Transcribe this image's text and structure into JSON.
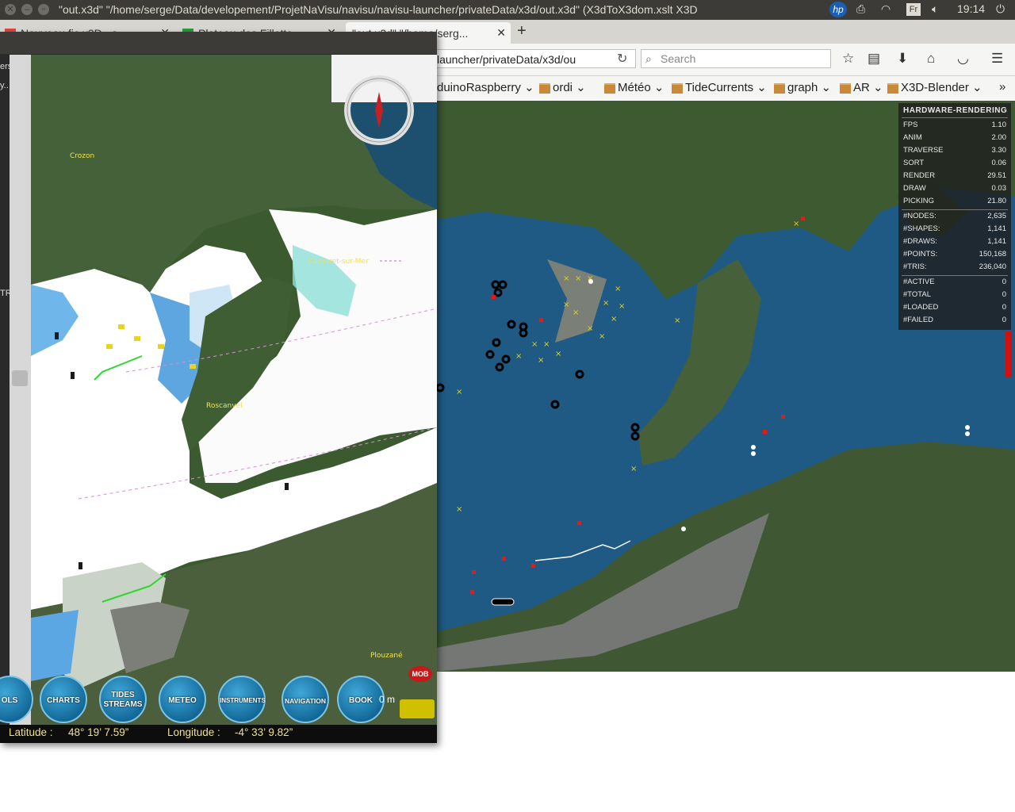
{
  "system": {
    "window_title": "\"out.x3d\" \"/home/serge/Data/developement/ProjetNaVisu/navisu/navisu-launcher/privateData/x3d/out.x3d\" (X3dToX3dom.xslt X3D",
    "keyboard_layout": "Fr",
    "clock": "19:14",
    "icons": [
      "hp-icon",
      "printer-icon",
      "wifi-icon",
      "volume-icon",
      "settings-icon"
    ]
  },
  "browser": {
    "tabs": [
      {
        "label": "Nouveau fic.x3D - s",
        "active": false
      },
      {
        "label": "Plateau des Fillette",
        "active": false
      },
      {
        "label": "\"out.x3d\" \"/home/serg...",
        "active": true
      }
    ],
    "url": "launcher/privateData/x3d/ou",
    "search_placeholder": "Search",
    "bookmarks": [
      {
        "label": "duinoRaspberry",
        "folder": false
      },
      {
        "label": "ordi",
        "folder": true
      },
      {
        "label": "Météo",
        "folder": true
      },
      {
        "label": "TideCurrents",
        "folder": true
      },
      {
        "label": "graph",
        "folder": true
      },
      {
        "label": "AR",
        "folder": true
      },
      {
        "label": "X3D-Blender",
        "folder": true
      }
    ]
  },
  "hud": {
    "title": "HARDWARE-RENDERING",
    "timings": [
      {
        "key": "FPS",
        "value": "1.10"
      },
      {
        "key": "ANIM",
        "value": "2.00"
      },
      {
        "key": "TRAVERSE",
        "value": "3.30"
      },
      {
        "key": "SORT",
        "value": "0.06"
      },
      {
        "key": "RENDER",
        "value": "29.51"
      },
      {
        "key": "DRAW",
        "value": "0.03"
      },
      {
        "key": "PICKING",
        "value": "21.80"
      }
    ],
    "counts": [
      {
        "key": "#NODES:",
        "value": "2,635"
      },
      {
        "key": "#SHAPES:",
        "value": "1,141"
      },
      {
        "key": "#DRAWS:",
        "value": "1,141"
      },
      {
        "key": "#POINTS:",
        "value": "150,168"
      },
      {
        "key": "#TRIS:",
        "value": "236,040"
      }
    ],
    "loading": [
      {
        "key": "#ACTIVE",
        "value": "0"
      },
      {
        "key": "#TOTAL",
        "value": "0"
      },
      {
        "key": "#LOADED",
        "value": "0"
      },
      {
        "key": "#FAILED",
        "value": "0"
      }
    ]
  },
  "navisu": {
    "left_edge_texts": [
      "ers",
      "y..",
      "TR"
    ],
    "place_labels": [
      "Crozon",
      "Camaret-sur-Mer",
      "Roscanvel",
      "Plouzané"
    ],
    "toolbar": [
      "OLS",
      "CHARTS",
      "TIDES STREAMS",
      "METEO",
      "INSTRUMENTS",
      "NAVIGATION",
      "BOOK"
    ],
    "scale_text": "0 m",
    "mob_label": "MOB",
    "latitude_label": "Latitude :",
    "latitude_value": "48° 19’ 7.59”",
    "longitude_label": "Longitude :",
    "longitude_value": "-4° 33’ 9.82”"
  },
  "colors": {
    "os_panel": "#3c3b37",
    "sea": "#1f5a84",
    "land": "#3d5a31",
    "status_text": "#f0e08a",
    "toolbar_button": "#1a7fb5"
  }
}
